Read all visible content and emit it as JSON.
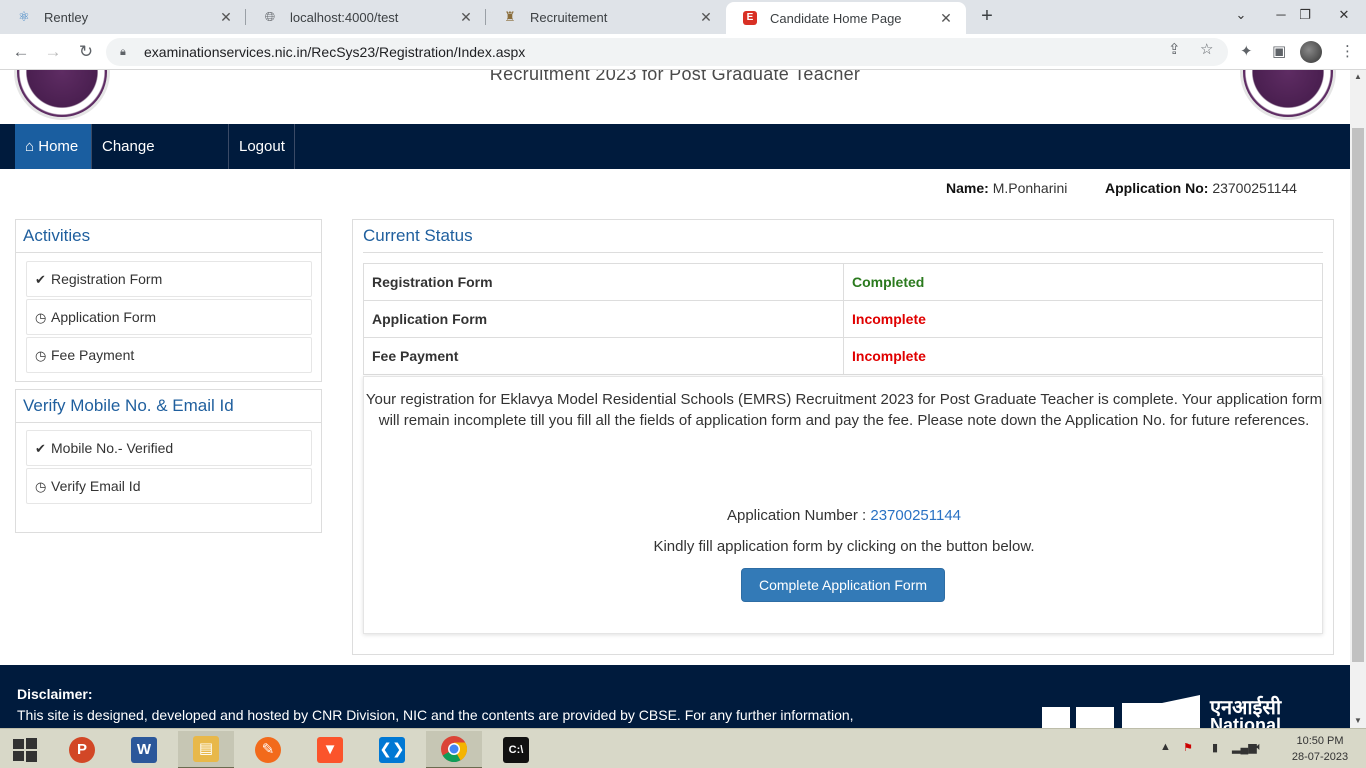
{
  "browser": {
    "tabs": [
      {
        "label": "Rentley",
        "icon": "react-icon"
      },
      {
        "label": "localhost:4000/test",
        "icon": "globe-icon"
      },
      {
        "label": "Recruitement",
        "icon": "emblem-icon"
      },
      {
        "label": "Candidate Home Page",
        "icon": "page-icon"
      }
    ],
    "url": "examinationservices.nic.in/RecSys23/Registration/Index.aspx"
  },
  "header": {
    "title": "Recruitment 2023 for Post Graduate Teacher"
  },
  "nav": {
    "home": "Home",
    "change_password": "Change Password",
    "logout": "Logout"
  },
  "candidate": {
    "name_label": "Name:",
    "name": "M.Ponharini",
    "appno_label": "Application No:",
    "appno": "23700251144"
  },
  "activities": {
    "title": "Activities",
    "items": [
      {
        "label": "Registration Form",
        "icon": "check-circle-icon"
      },
      {
        "label": "Application Form",
        "icon": "clock-icon"
      },
      {
        "label": "Fee Payment",
        "icon": "clock-icon"
      }
    ]
  },
  "verify": {
    "title": "Verify Mobile No. & Email Id",
    "items": [
      {
        "label": "Mobile No.- Verified",
        "icon": "check-circle-icon"
      },
      {
        "label": "Verify Email Id",
        "icon": "clock-icon"
      }
    ]
  },
  "status": {
    "title": "Current Status",
    "rows": [
      {
        "item": "Registration Form",
        "state": "Completed"
      },
      {
        "item": "Application Form",
        "state": "Incomplete"
      },
      {
        "item": "Fee Payment",
        "state": "Incomplete"
      }
    ],
    "message": "Your registration for Eklavya Model Residential Schools (EMRS) Recruitment 2023 for Post Graduate Teacher is complete. Your application form will remain incomplete till you fill all the fields of application form and pay the fee. Please note down the Application No. for future references.",
    "appno_label": "Application Number :",
    "appno": "23700251144",
    "instruction": "Kindly fill application form by clicking on the button below.",
    "button": "Complete Application Form"
  },
  "footer": {
    "disclaimer_title": "Disclaimer:",
    "disclaimer_text": "This site is designed, developed and hosted by CNR Division, NIC and the contents are provided by CBSE. For any further information,",
    "nic_hindi": "एनआईसी",
    "nic_en": "National"
  },
  "taskbar": {
    "time": "10:50 PM",
    "date": "28-07-2023"
  }
}
